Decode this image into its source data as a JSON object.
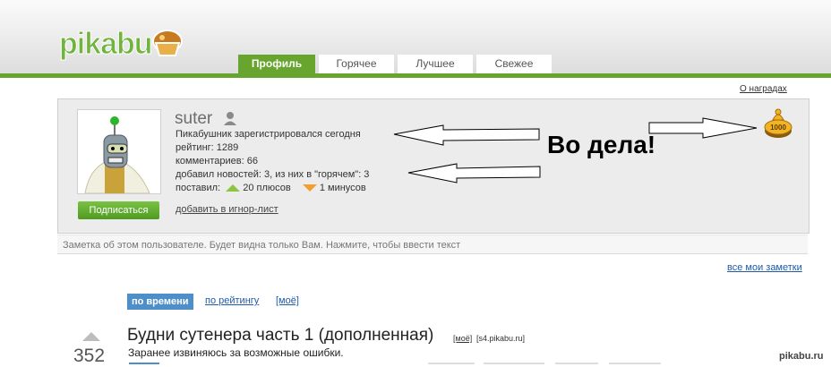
{
  "header": {
    "logo_text": "pikabu",
    "tabs": [
      {
        "label": "Профиль",
        "active": true
      },
      {
        "label": "Горячее",
        "active": false
      },
      {
        "label": "Лучшее",
        "active": false
      },
      {
        "label": "Свежее",
        "active": false
      }
    ]
  },
  "awards_link": "О наградах",
  "profile": {
    "username": "suter",
    "registered": "Пикабушник зарегистрировался сегодня",
    "rating": "рейтинг: 1289",
    "comments": "комментариев: 66",
    "news": "добавил новостей: 3, из них в \"горячем\": 3",
    "votes_label": "поставил:",
    "plus": "20 плюсов",
    "minus": "1 минусов",
    "subscribe_label": "Подписаться",
    "ignore_label": "добавить в игнор-лист",
    "award_badge": "1000"
  },
  "note_placeholder": "Заметка об этом пользователе. Будет видна только Вам. Нажмите, чтобы ввести текст",
  "all_notes": "все мои заметки",
  "sort": {
    "by_time": "по времени",
    "by_rating": "по рейтингу",
    "mine": "[моё]"
  },
  "post": {
    "score": "352",
    "title": "Будни сутенера часть 1 (дополненная)",
    "mine_tag": "[моё]",
    "source": "[s4.pikabu.ru]",
    "text": "Заранее извиняюсь за возможные ошибки."
  },
  "annotation": "Во дела!",
  "watermark": "pikabu.ru",
  "colors": {
    "brand_green": "#67a52e",
    "link_blue": "#1f5aa8",
    "sort_blue": "#4e8fc9",
    "plus_green": "#8cc63f",
    "minus_orange": "#f0a030"
  },
  "icons": [
    "cupcake-logo-icon",
    "user-icon",
    "award-icon",
    "arrow-up-icon",
    "triangle-up-icon",
    "triangle-down-icon"
  ]
}
